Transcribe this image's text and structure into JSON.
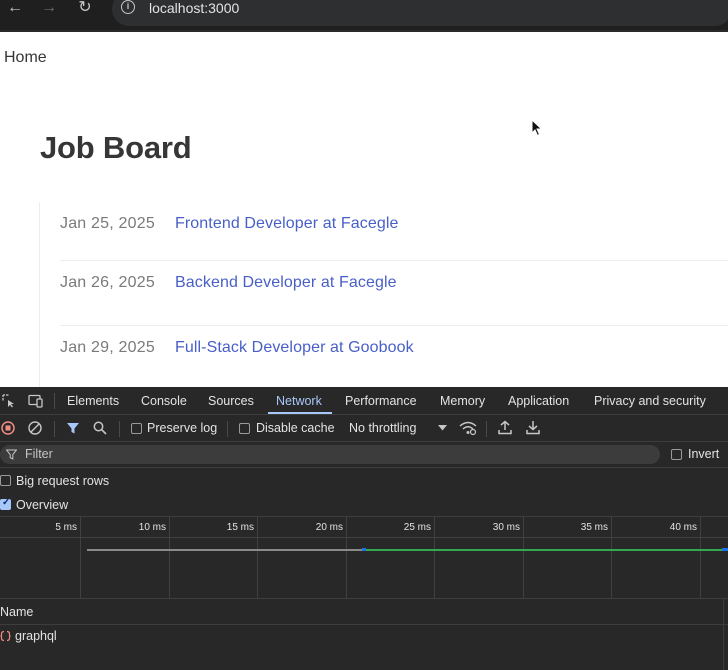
{
  "browser": {
    "back_icon": "arrow-left-icon",
    "forward_icon": "arrow-right-icon",
    "reload_icon": "reload-icon",
    "info_icon": "info-icon",
    "url": "localhost:3000"
  },
  "page": {
    "home_link": "Home",
    "title": "Job Board",
    "jobs": [
      {
        "date": "Jan 25, 2025",
        "title": "Frontend Developer at Facegle"
      },
      {
        "date": "Jan 26, 2025",
        "title": "Backend Developer at Facegle"
      },
      {
        "date": "Jan 29, 2025",
        "title": "Full-Stack Developer at Goobook"
      }
    ],
    "colors": {
      "link": "#485fc7",
      "heading": "#363636",
      "muted": "#7a7a7a"
    }
  },
  "devtools": {
    "tabs": [
      "Elements",
      "Console",
      "Sources",
      "Network",
      "Performance",
      "Memory",
      "Application",
      "Privacy and security"
    ],
    "active_tab": "Network",
    "toolbar": {
      "preserve_log": "Preserve log",
      "disable_cache": "Disable cache",
      "throttling": "No throttling"
    },
    "filter": {
      "placeholder": "Filter",
      "invert": "Invert"
    },
    "options": {
      "big_request_rows": "Big request rows",
      "overview": "Overview"
    },
    "timeline_ticks": [
      "5 ms",
      "10 ms",
      "15 ms",
      "20 ms",
      "25 ms",
      "30 ms",
      "35 ms",
      "40 ms"
    ],
    "table": {
      "name_header": "Name",
      "requests": [
        {
          "name": "graphql"
        }
      ]
    },
    "colors": {
      "accent": "#a8c7fa",
      "record": "#f28b82",
      "waterfall_green": "#34a853"
    }
  }
}
